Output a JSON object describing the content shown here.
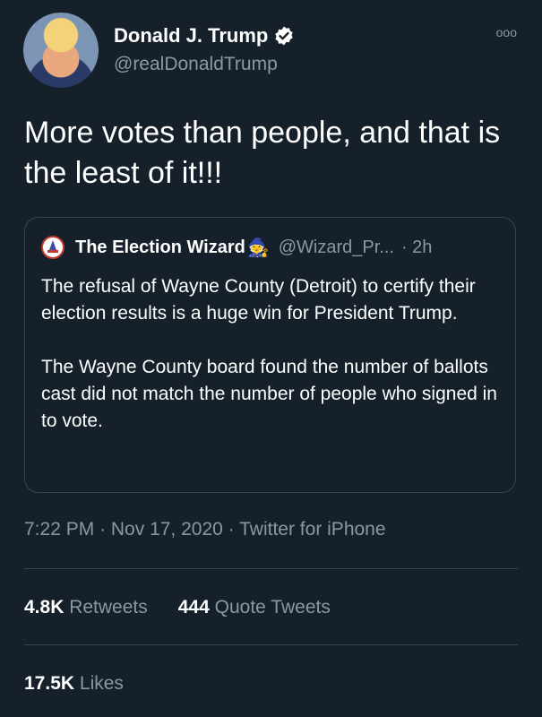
{
  "author": {
    "name": "Donald J. Trump",
    "handle": "@realDonaldTrump",
    "verified_icon": "verified-badge-icon"
  },
  "more_icon": "ooo",
  "tweet": {
    "text": "More votes than people, and that is the least of it!!!"
  },
  "quoted": {
    "name": "The Election Wizard",
    "emoji": "🧙",
    "handle": "@Wizard_Pr...",
    "time": "· 2h",
    "paragraphs": [
      "The refusal of Wayne County (Detroit) to certify their election results is a huge win for President Trump.",
      "The Wayne County board found the number of ballots cast did not match the number of people who signed in to vote."
    ]
  },
  "meta": {
    "time": "7:22 PM",
    "date": "Nov 17, 2020",
    "source": "Twitter for iPhone"
  },
  "stats": {
    "retweets_count": "4.8K",
    "retweets_label": "Retweets",
    "quotes_count": "444",
    "quotes_label": "Quote Tweets",
    "likes_count": "17.5K",
    "likes_label": "Likes"
  },
  "colors": {
    "background": "#15202b",
    "secondary_text": "#8899a6",
    "border": "#38444d",
    "verified": "#ffffff"
  }
}
